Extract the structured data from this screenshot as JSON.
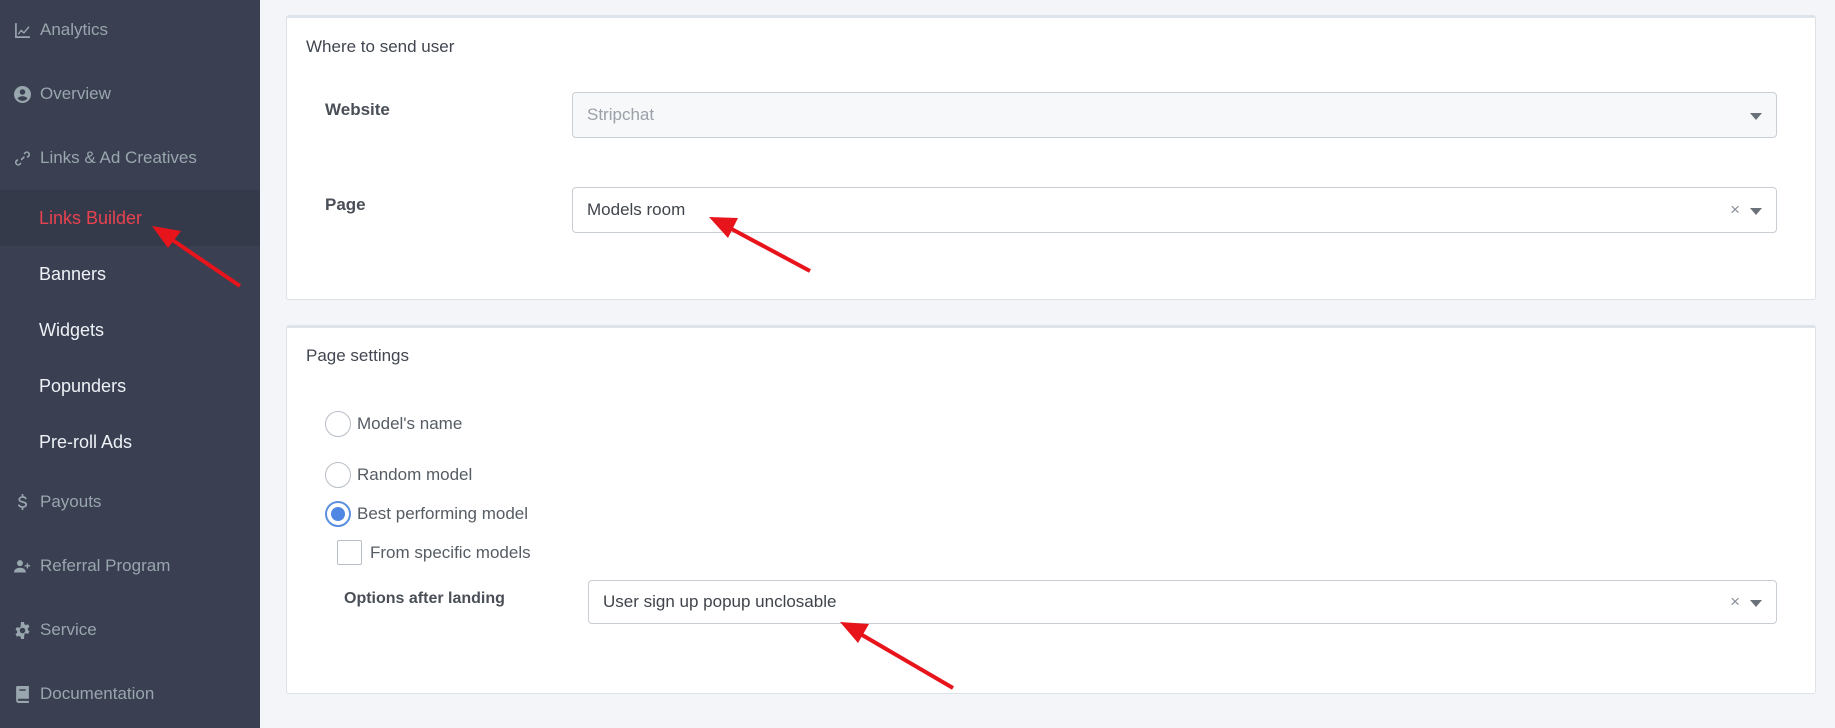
{
  "sidebar": {
    "items": [
      {
        "label": "Analytics",
        "icon": "chart-line-icon"
      },
      {
        "label": "Overview",
        "icon": "user-circle-icon"
      },
      {
        "label": "Links & Ad Creatives",
        "icon": "link-icon"
      },
      {
        "label": "Payouts",
        "icon": "dollar-icon"
      },
      {
        "label": "Referral Program",
        "icon": "user-plus-icon"
      },
      {
        "label": "Service",
        "icon": "gear-icon"
      },
      {
        "label": "Documentation",
        "icon": "book-icon"
      }
    ],
    "subitems": [
      {
        "label": "Links Builder",
        "active": true
      },
      {
        "label": "Banners"
      },
      {
        "label": "Widgets"
      },
      {
        "label": "Popunders"
      },
      {
        "label": "Pre-roll Ads"
      }
    ]
  },
  "send_user": {
    "title": "Where to send user",
    "website_label": "Website",
    "website_value": "Stripchat",
    "page_label": "Page",
    "page_value": "Models room"
  },
  "page_settings": {
    "title": "Page settings",
    "options": [
      {
        "label": "Model's name",
        "checked": false
      },
      {
        "label": "Random model",
        "checked": false
      },
      {
        "label": "Best performing model",
        "checked": true
      }
    ],
    "specific_models_label": "From specific models",
    "landing_label": "Options after landing",
    "landing_value": "User sign up popup unclosable"
  },
  "colors": {
    "sidebar_bg": "#3a3f51",
    "active_link": "#e8424f",
    "radio_accent": "#4f87e2",
    "annotation_arrow": "#e8141b"
  },
  "clear_glyph": "×"
}
